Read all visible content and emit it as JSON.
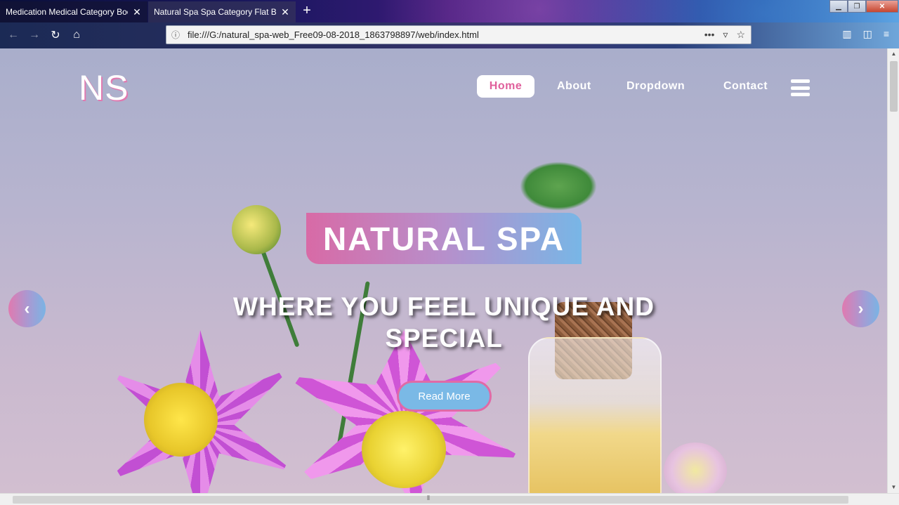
{
  "browser": {
    "tabs": [
      {
        "label": "Medication Medical Category Boot"
      },
      {
        "label": "Natural Spa Spa Category Flat Boot"
      }
    ],
    "url": "file:///G:/natural_spa-web_Free09-08-2018_1863798897/web/index.html"
  },
  "site": {
    "logo": "NS",
    "nav": {
      "home": "Home",
      "about": "About",
      "dropdown": "Dropdown",
      "contact": "Contact"
    },
    "hero": {
      "badge": "NATURAL SPA",
      "headline": "WHERE YOU FEEL UNIQUE AND SPECIAL",
      "cta": "Read More"
    }
  },
  "colors": {
    "accent_pink": "#e06aa6",
    "accent_blue": "#7ab9e6"
  }
}
